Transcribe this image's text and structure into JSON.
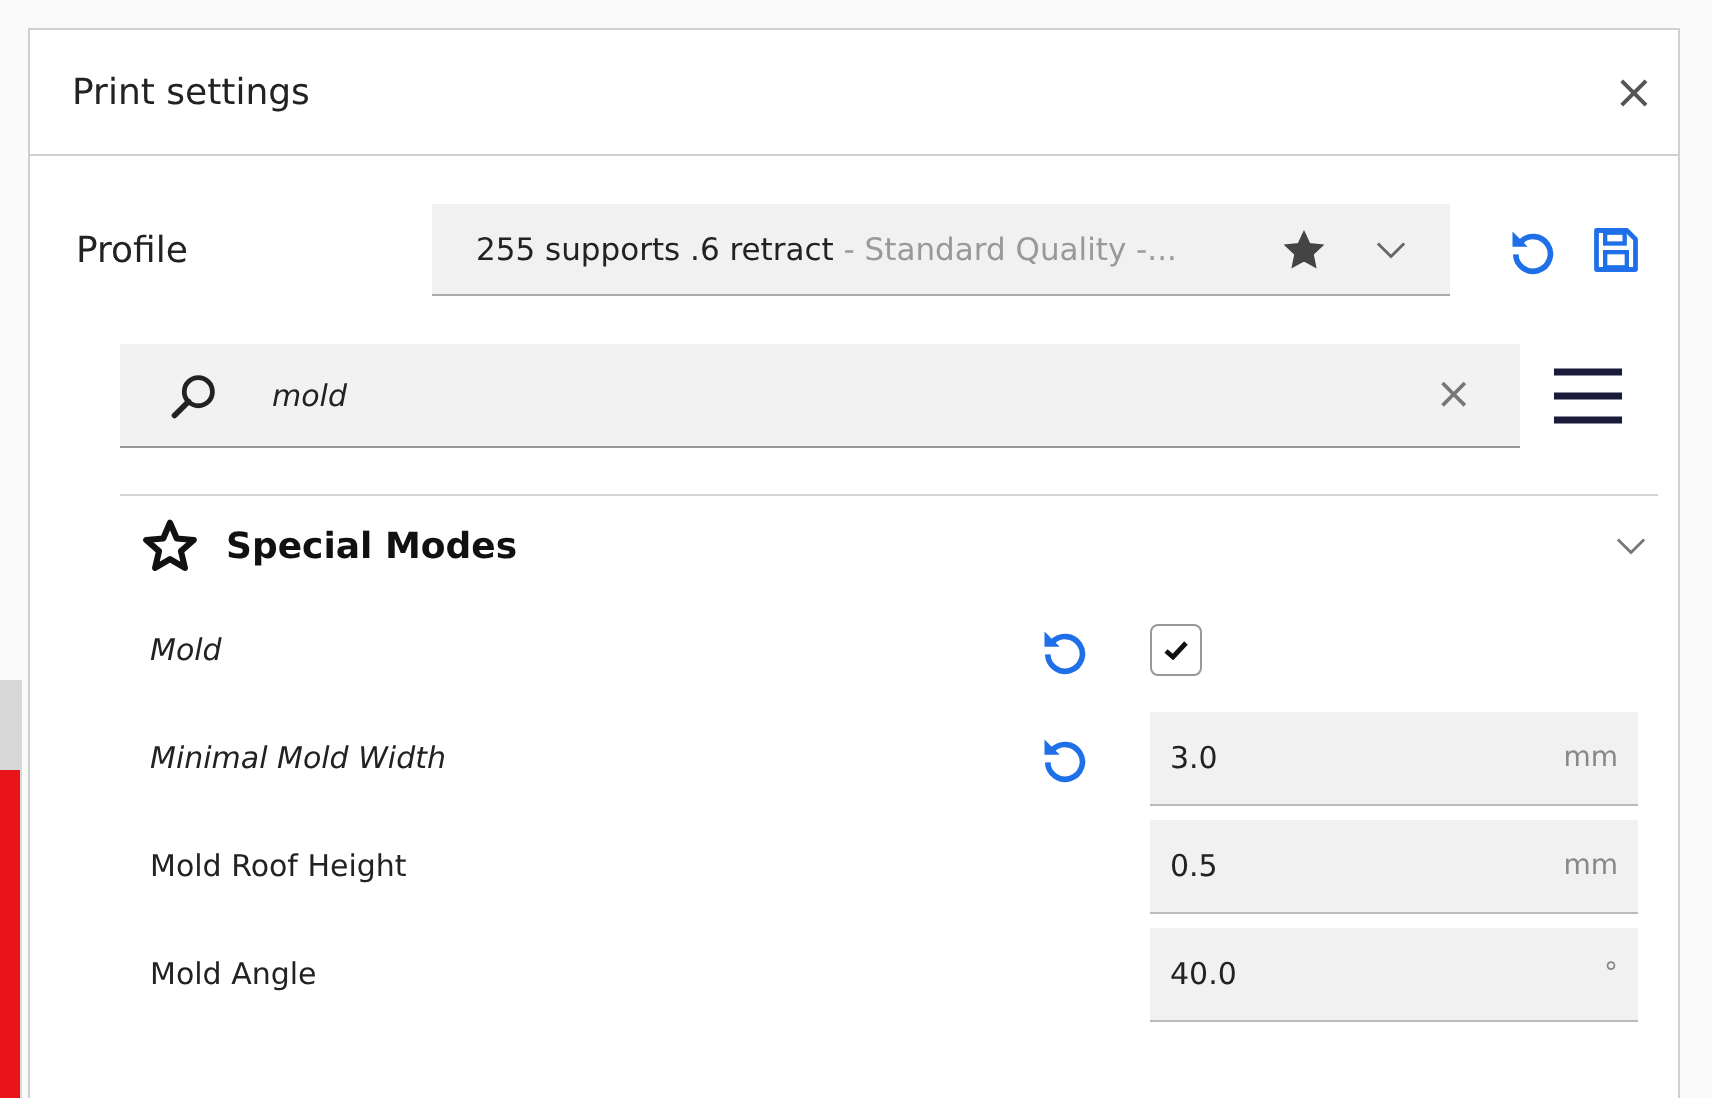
{
  "window": {
    "title": "Print settings",
    "close": "×"
  },
  "profile": {
    "label": "Profile",
    "name": "255 supports .6 retract",
    "detail": " - Standard Quality -...",
    "favorite": true
  },
  "search": {
    "value": "mold",
    "clear": "×"
  },
  "category": {
    "title": "Special Modes",
    "expanded": true
  },
  "settings": [
    {
      "kind": "checkbox",
      "label": "Mold",
      "modified": true,
      "checked": true
    },
    {
      "kind": "number",
      "label": "Minimal Mold Width",
      "modified": true,
      "value": "3.0",
      "unit": "mm"
    },
    {
      "kind": "number",
      "label": "Mold Roof Height",
      "modified": false,
      "value": "0.5",
      "unit": "mm"
    },
    {
      "kind": "number",
      "label": "Mold Angle",
      "modified": false,
      "value": "40.0",
      "unit": "°"
    }
  ]
}
